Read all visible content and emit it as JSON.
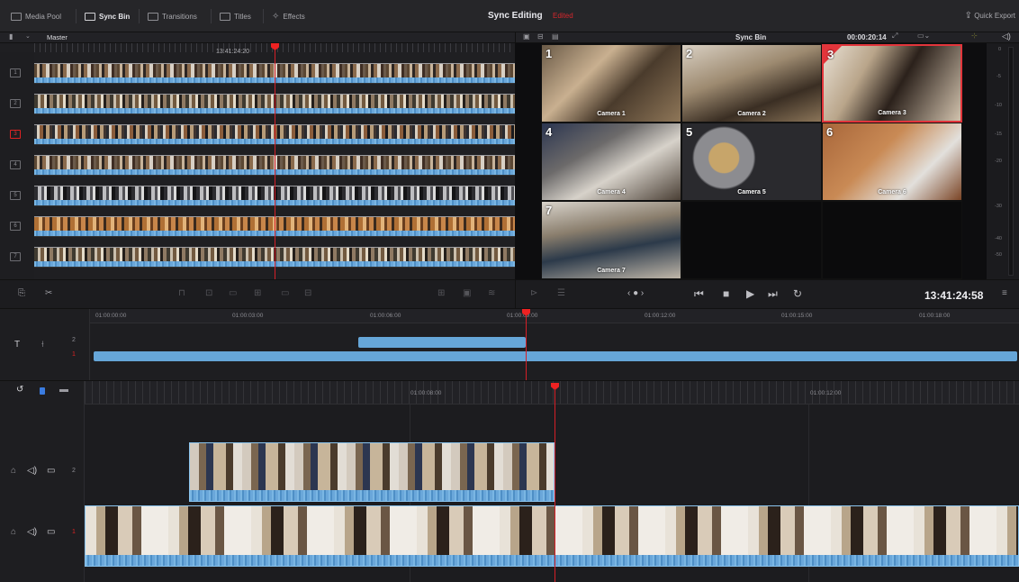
{
  "topbar": {
    "media_pool": "Media Pool",
    "sync_bin": "Sync Bin",
    "transitions": "Transitions",
    "titles": "Titles",
    "effects": "Effects",
    "title": "Sync Editing",
    "status": "Edited",
    "quick_export": "Quick Export"
  },
  "source_viewer": {
    "bin_name": "Master",
    "timecode_overlay": "13:41:24:20",
    "tracks": [
      "1",
      "2",
      "3",
      "4",
      "5",
      "6",
      "7"
    ],
    "selected_track": "3"
  },
  "sync_viewer": {
    "title": "Sync Bin",
    "timecode": "00:00:20:14",
    "cameras": [
      {
        "num": "1",
        "label": "Camera 1"
      },
      {
        "num": "2",
        "label": "Camera 2"
      },
      {
        "num": "3",
        "label": "Camera 3"
      },
      {
        "num": "4",
        "label": "Camera 4"
      },
      {
        "num": "5",
        "label": "Camera 5"
      },
      {
        "num": "6",
        "label": "Camera 6"
      },
      {
        "num": "7",
        "label": "Camera 7"
      }
    ],
    "selected_camera": "3",
    "playback_timecode": "13:41:24:58",
    "meter_scale": [
      "0",
      "-5",
      "-10",
      "-15",
      "-20",
      "-30",
      "-40",
      "-50"
    ]
  },
  "upper_timeline": {
    "ruler": [
      "01:00:00:00",
      "01:00:03:00",
      "01:00:06:00",
      "01:00:09:00",
      "01:00:12:00",
      "01:00:15:00",
      "01:00:18:00"
    ],
    "tracks": [
      "2",
      "1"
    ]
  },
  "lower_timeline": {
    "ruler": [
      "01:00:08:00",
      "01:00:12:00"
    ],
    "tracks": [
      "2",
      "1"
    ]
  },
  "colors": {
    "accent_red": "#d51f27",
    "clip_blue": "#66a6d8"
  }
}
